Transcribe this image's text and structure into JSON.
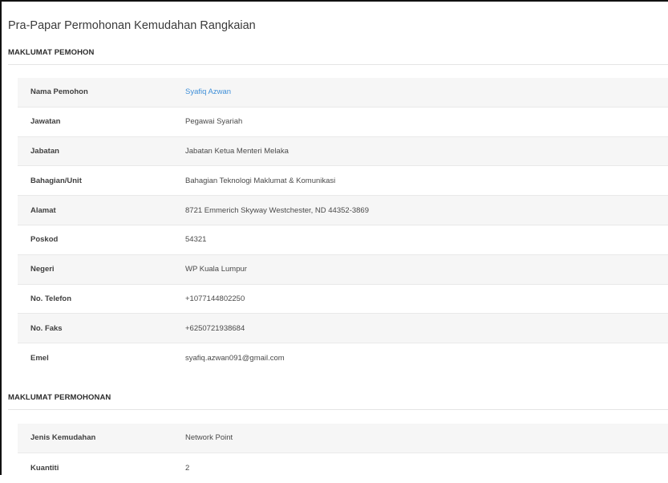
{
  "page": {
    "title": "Pra-Papar Permohonan Kemudahan Rangkaian"
  },
  "applicant_section": {
    "title": "MAKLUMAT PEMOHON",
    "rows": [
      {
        "label": "Nama Pemohon",
        "value": "Syafiq Azwan"
      },
      {
        "label": "Jawatan",
        "value": "Pegawai Syariah"
      },
      {
        "label": "Jabatan",
        "value": "Jabatan Ketua Menteri Melaka"
      },
      {
        "label": "Bahagian/Unit",
        "value": "Bahagian Teknologi Maklumat & Komunikasi"
      },
      {
        "label": "Alamat",
        "value": "8721 Emmerich Skyway Westchester, ND 44352-3869"
      },
      {
        "label": "Poskod",
        "value": "54321"
      },
      {
        "label": "Negeri",
        "value": "WP Kuala Lumpur"
      },
      {
        "label": "No. Telefon",
        "value": "+1077144802250"
      },
      {
        "label": "No. Faks",
        "value": "+6250721938684"
      },
      {
        "label": "Emel",
        "value": "syafiq.azwan091@gmail.com"
      }
    ]
  },
  "application_section": {
    "title": "MAKLUMAT PERMOHONAN",
    "rows": [
      {
        "label": "Jenis Kemudahan",
        "value": "Network Point"
      },
      {
        "label": "Kuantiti",
        "value": "2"
      }
    ]
  },
  "colors": {
    "link": "#3f8fd8",
    "stripe": "#f6f6f6"
  }
}
